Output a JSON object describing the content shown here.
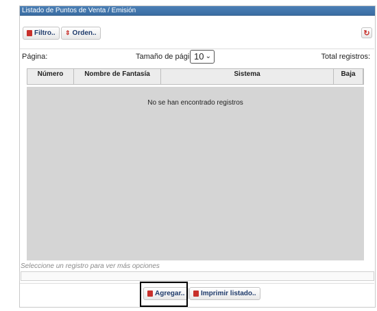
{
  "panel": {
    "title": "Listado de Puntos de Venta / Emisión"
  },
  "toolbar": {
    "filter_label": "Filtro..",
    "order_label": "Orden..",
    "refresh_icon": "refresh-icon"
  },
  "pager": {
    "page_label": "Página:",
    "page_size_label": "Tamaño de página:",
    "page_size_value": "10",
    "total_label": "Total registros:"
  },
  "table": {
    "columns": [
      "Número",
      "Nombre de Fantasía",
      "Sistema",
      "Baja"
    ],
    "empty_message": "No se han encontrado registros"
  },
  "hint": "Seleccione un registro para ver más opciones",
  "actions": {
    "add_label": "Agregar..",
    "print_label": "Imprimir listado.."
  },
  "colors": {
    "titlebar": "#3a6da3",
    "button_text": "#1e3a6b",
    "table_body": "#d5d5d5",
    "icon_red": "#c8302b"
  }
}
